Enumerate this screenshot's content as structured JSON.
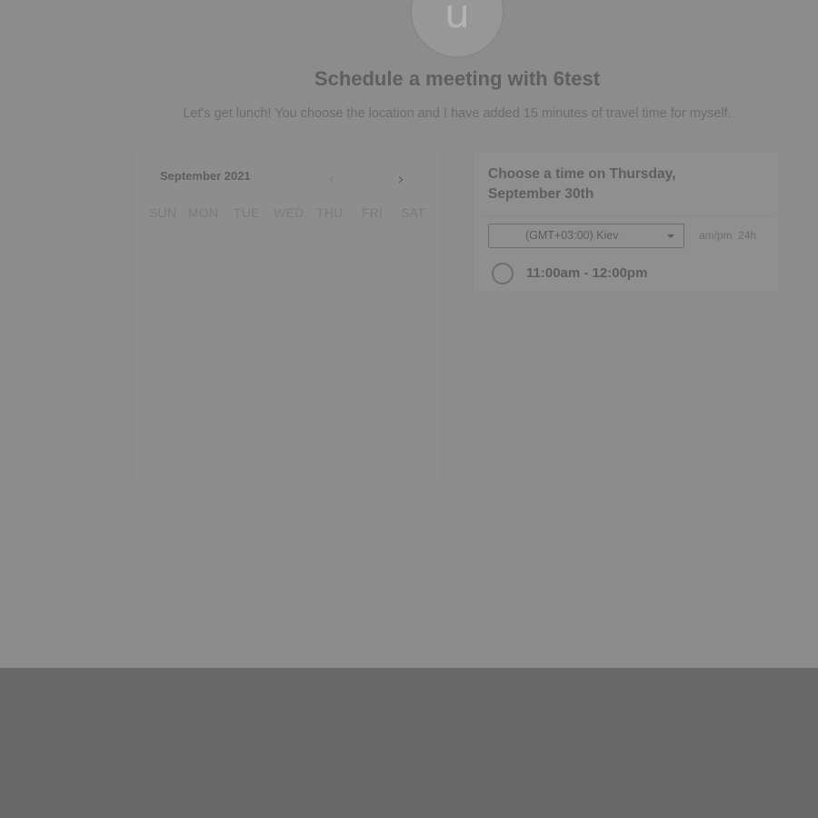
{
  "header": {
    "avatar_initial": "u",
    "title": "Schedule a meeting with 6test",
    "description": "Let's get lunch! You choose the location and I have added 15 minutes of travel time for myself."
  },
  "calendar": {
    "month_label": "September 2021",
    "prev_icon": "chevron-left",
    "next_icon": "chevron-right",
    "weekdays": [
      "SUN",
      "MON",
      "TUE",
      "WED",
      "THU",
      "FRI",
      "SAT"
    ]
  },
  "slots": {
    "heading": "Choose a time on Thursday, September 30th",
    "timezone_value": "(GMT+03:00) Kiev",
    "format_options": [
      "am/pm",
      "24h"
    ],
    "times": [
      "11:00am - 12:00pm"
    ]
  },
  "colors": {
    "overlay": "#8c8c8c",
    "footer": "#676767"
  }
}
